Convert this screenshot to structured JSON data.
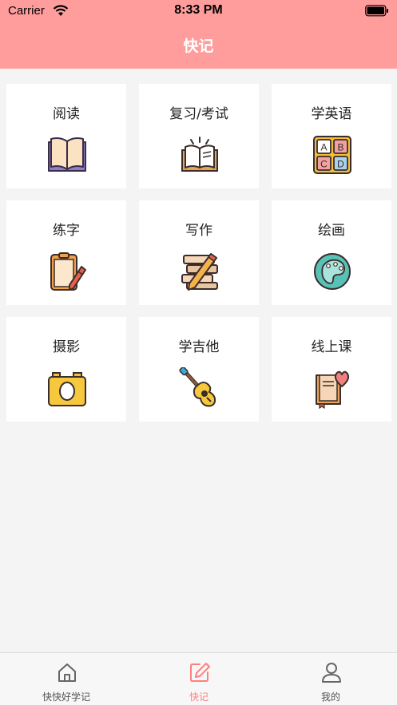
{
  "status_bar": {
    "carrier": "Carrier",
    "time": "8:33 PM"
  },
  "nav": {
    "title": "快记"
  },
  "grid": {
    "items": [
      {
        "label": "阅读",
        "icon": "open-book-icon"
      },
      {
        "label": "复习/考试",
        "icon": "study-book-icon"
      },
      {
        "label": "学英语",
        "icon": "abcd-blocks-icon"
      },
      {
        "label": "练字",
        "icon": "clipboard-pencil-icon"
      },
      {
        "label": "写作",
        "icon": "books-pencil-icon"
      },
      {
        "label": "绘画",
        "icon": "palette-icon"
      },
      {
        "label": "摄影",
        "icon": "camera-icon"
      },
      {
        "label": "学吉他",
        "icon": "guitar-icon"
      },
      {
        "label": "线上课",
        "icon": "book-heart-icon"
      }
    ],
    "abcd": [
      "A",
      "B",
      "C",
      "D"
    ]
  },
  "tabbar": {
    "tabs": [
      {
        "label": "快快好学记",
        "icon": "home-icon",
        "active": false
      },
      {
        "label": "快记",
        "icon": "edit-icon",
        "active": true
      },
      {
        "label": "我的",
        "icon": "user-icon",
        "active": false
      }
    ],
    "active_color": "#ff7f7f"
  },
  "colors": {
    "header": "#ff9d9d",
    "background": "#f4f4f4"
  }
}
